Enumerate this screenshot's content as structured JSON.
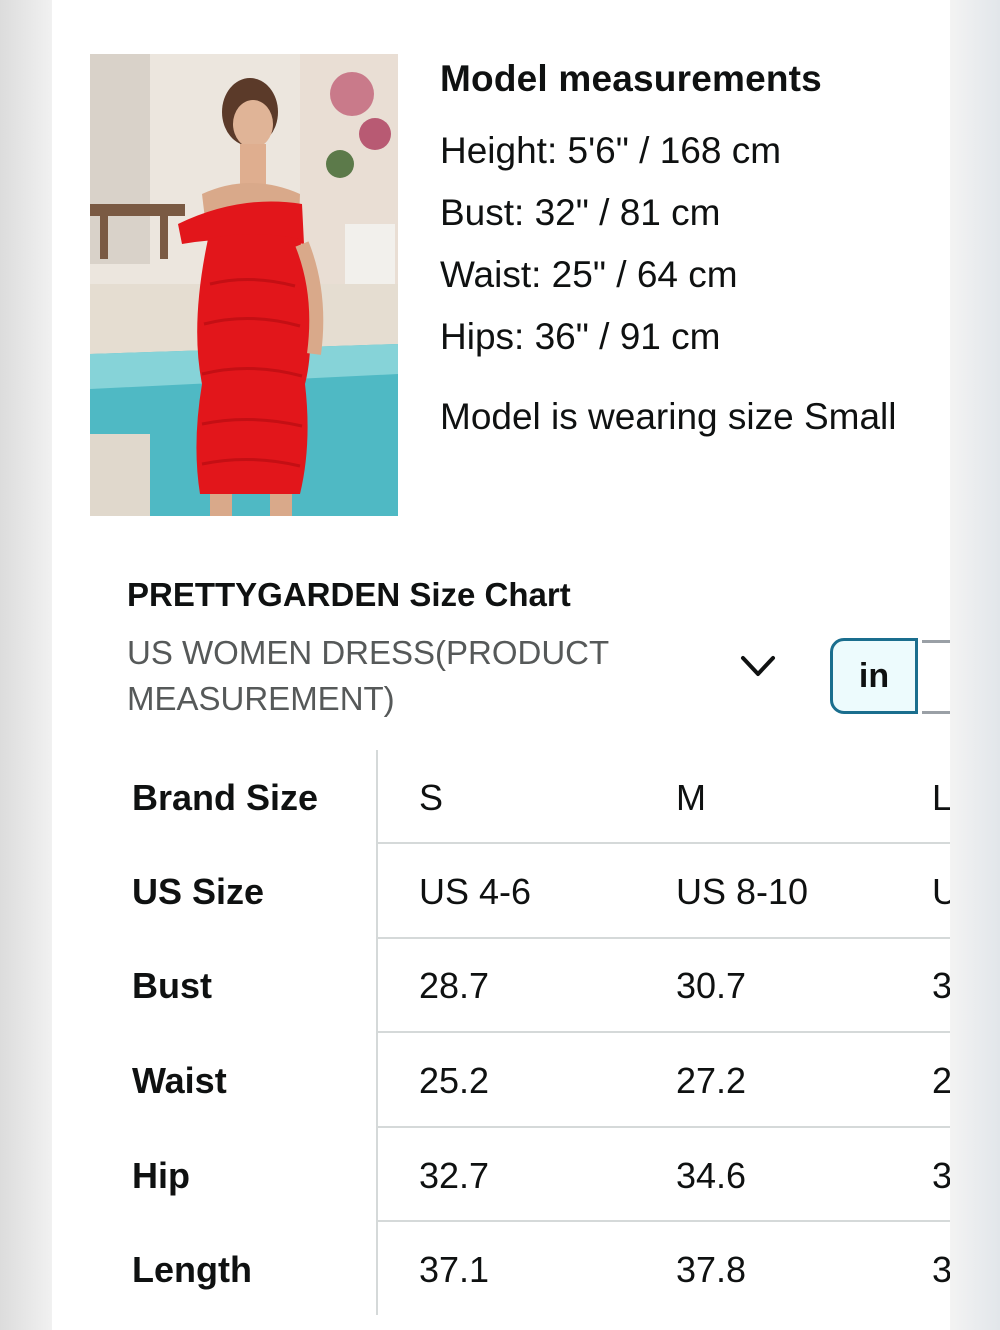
{
  "model": {
    "title": "Model measurements",
    "height": "Height: 5'6\" / 168 cm",
    "bust": "Bust: 32\" / 81 cm",
    "waist": "Waist: 25\" / 64 cm",
    "hips": "Hips: 36\" / 91 cm",
    "wearing": "Model is wearing size Small"
  },
  "size_chart": {
    "title": "PRETTYGARDEN Size Chart",
    "category": "US WOMEN DRESS(PRODUCT MEASUREMENT)",
    "unit_in": "in",
    "rows": [
      {
        "label": "Brand Size",
        "s": "S",
        "m": "M",
        "l": "L"
      },
      {
        "label": "US Size",
        "s": "US 4-6",
        "m": "US 8-10",
        "l": "U"
      },
      {
        "label": "Bust",
        "s": "28.7",
        "m": "30.7",
        "l": "3"
      },
      {
        "label": "Waist",
        "s": "25.2",
        "m": "27.2",
        "l": "2"
      },
      {
        "label": "Hip",
        "s": "32.7",
        "m": "34.6",
        "l": "3"
      },
      {
        "label": "Length",
        "s": "37.1",
        "m": "37.8",
        "l": "3"
      }
    ]
  },
  "colors": {
    "accent": "#1a6e8e",
    "toggle_bg": "#edfbfd",
    "dress": "#e2161b"
  }
}
